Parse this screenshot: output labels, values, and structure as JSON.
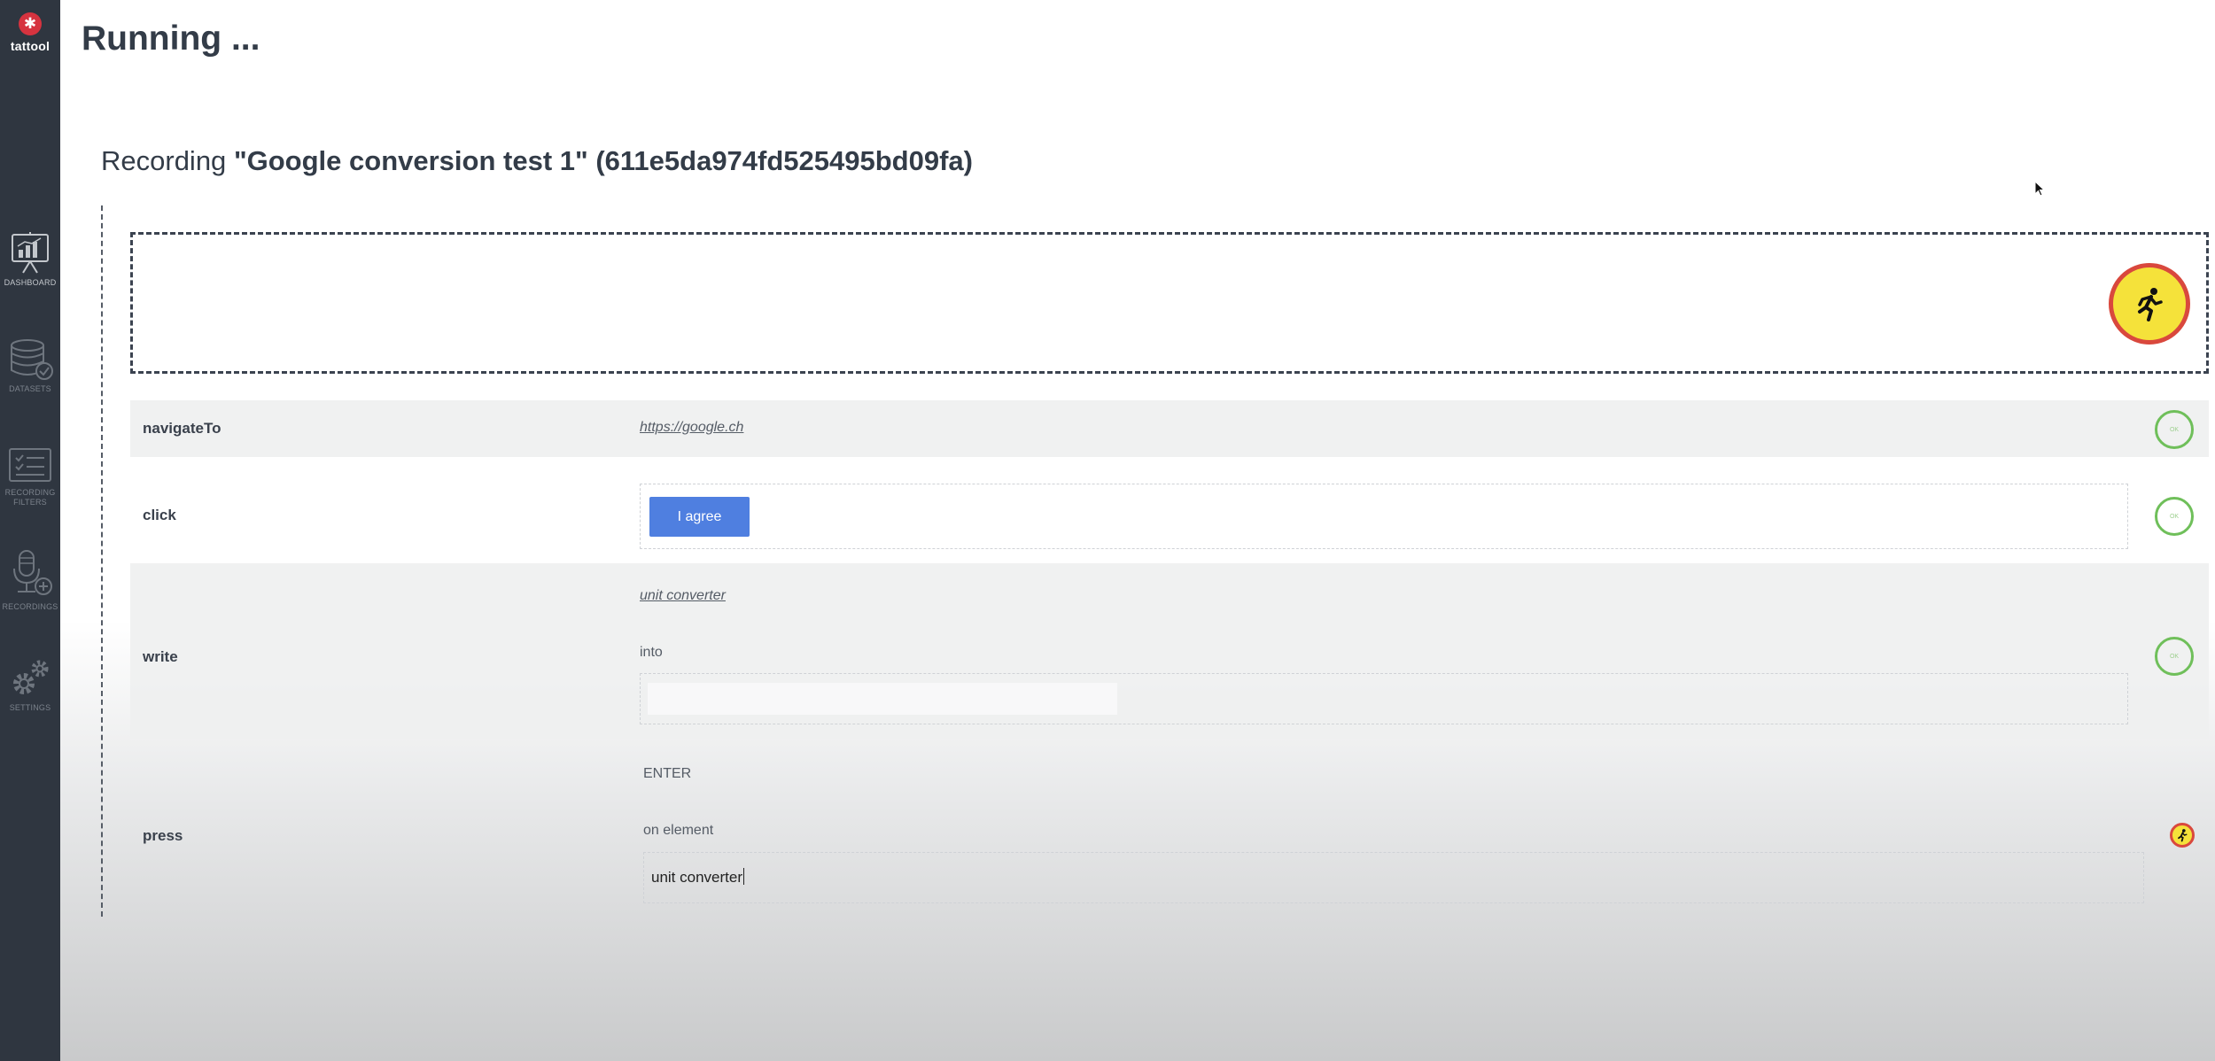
{
  "app": {
    "logo_text": "tattool",
    "page_title": "Running ..."
  },
  "sidebar": {
    "items": [
      {
        "label": "DASHBOARD",
        "icon": "dashboard-icon",
        "active": true
      },
      {
        "label": "DATASETS",
        "icon": "database-icon",
        "active": false
      },
      {
        "label": "RECORDING FILTERS",
        "icon": "filter-list-icon",
        "active": false
      },
      {
        "label": "RECORDINGS",
        "icon": "microphone-add-icon",
        "active": false
      },
      {
        "label": "SETTINGS",
        "icon": "gears-icon",
        "active": false
      }
    ]
  },
  "recording": {
    "prefix": "Recording",
    "name": "\"Google conversion test 1\"",
    "id": "(611e5da974fd525495bd09fa)"
  },
  "run_button": {
    "icon": "running-person-icon"
  },
  "steps": [
    {
      "action": "navigateTo",
      "link": "https://google.ch",
      "status": "ok",
      "status_label": "OK"
    },
    {
      "action": "click",
      "button_label": "I agree",
      "status": "ok",
      "status_label": "OK"
    },
    {
      "action": "write",
      "link": "unit converter",
      "connector": "into",
      "field_value": "",
      "status": "ok",
      "status_label": "OK"
    },
    {
      "action": "press",
      "key": "ENTER",
      "connector": "on element",
      "field_value": "unit converter",
      "status": "running"
    }
  ],
  "colors": {
    "sidebar_bg": "#2f3640",
    "logo_red": "#d6333f",
    "run_yellow": "#f5e23a",
    "run_border": "#d9483d",
    "ok_green": "#6fbf5a",
    "button_blue": "#4f7fe0"
  }
}
